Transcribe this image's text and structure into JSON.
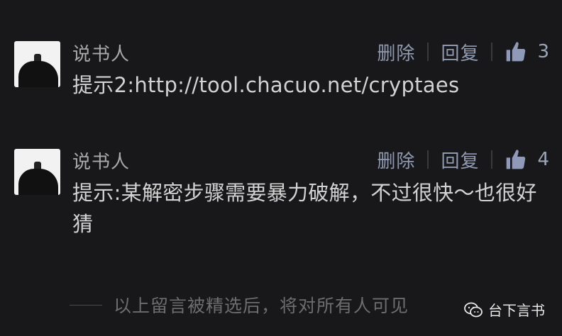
{
  "comments": [
    {
      "author": "说书人",
      "delete_label": "删除",
      "reply_label": "回复",
      "likes": "3",
      "text": "提示2:http://tool.chacuo.net/cryptaes"
    },
    {
      "author": "说书人",
      "delete_label": "删除",
      "reply_label": "回复",
      "likes": "4",
      "text": "提示:某解密步骤需要暴力破解，不过很快～也很好猜"
    }
  ],
  "footer": {
    "note": "以上留言被精选后，将对所有人可见"
  },
  "watermark": {
    "account": "台下言书",
    "icon": "wechat-icon"
  },
  "colors": {
    "background": "#18181a",
    "action": "#8f9ab0",
    "text": "#d2d2d2"
  }
}
